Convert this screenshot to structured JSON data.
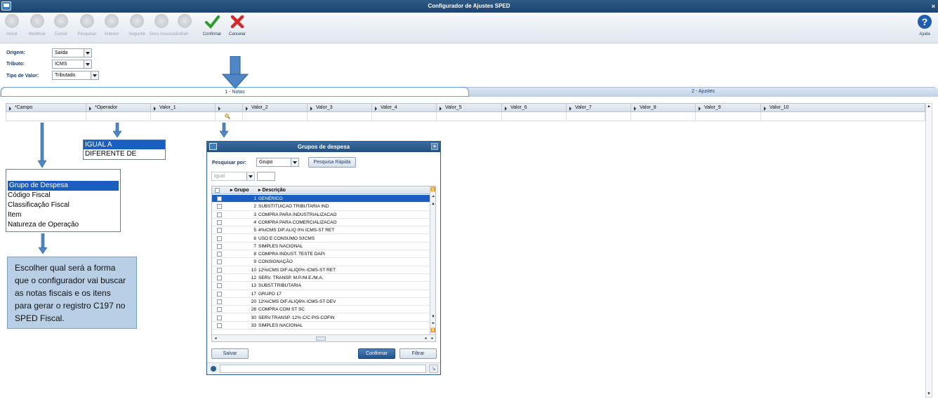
{
  "window": {
    "title": "Configurador de Ajustes SPED"
  },
  "toolbar": {
    "buttons": [
      {
        "label": "Incluir",
        "enabled": false
      },
      {
        "label": "Modificar",
        "enabled": false
      },
      {
        "label": "Excluir",
        "enabled": false
      },
      {
        "label": "Pesquisar",
        "enabled": false
      },
      {
        "label": "Anterior",
        "enabled": false
      },
      {
        "label": "Seguinte",
        "enabled": false
      },
      {
        "label": "Docs Associados",
        "enabled": false
      },
      {
        "label": "Sair",
        "enabled": false
      },
      {
        "label": "Confirmar",
        "enabled": true
      },
      {
        "label": "Cancelar",
        "enabled": true
      }
    ],
    "help_label": "Ajuda"
  },
  "form": {
    "origem_label": "Origem:",
    "origem_value": "Saída",
    "tributo_label": "Tributo:",
    "tributo_value": "ICMS",
    "tipo_label": "Tipo de Valor:",
    "tipo_value": "Tributado"
  },
  "tabs": [
    {
      "label": "1 - Notas",
      "active": true
    },
    {
      "label": "2 - Ajustes",
      "active": false
    }
  ],
  "grid": {
    "columns": [
      "*Campo",
      "*Operador",
      "Valor_1",
      "",
      "Valor_2",
      "Valor_3",
      "Valor_4",
      "Valor_5",
      "Valor_6",
      "Valor_7",
      "Valor_8",
      "Valor_9",
      "Valor_10"
    ]
  },
  "operador_dropdown": [
    "IGUAL A",
    "DIFERENTE DE"
  ],
  "campo_dropdown": [
    "",
    "Grupo de Despesa",
    "Código Fiscal",
    "Classificação Fiscal",
    "Item",
    "Natureza de Operação"
  ],
  "callout": "Escolher qual será a forma que o configurador vai buscar as notas fiscais e os itens para gerar o registro C197 no SPED Fiscal.",
  "dialog": {
    "title": "Grupos de despesa",
    "search_label": "Pesquisar por:",
    "search_field": "Grupo",
    "quick_search_btn": "Pesquisa Rápida",
    "operator": "Igual",
    "search_value": "",
    "col_grupo": "Grupo",
    "col_descricao": "Descrição",
    "rows": [
      {
        "grupo": "1",
        "descricao": "GENÉRICO"
      },
      {
        "grupo": "2",
        "descricao": "SUBSTITUICAO TRIBUTARIA IND"
      },
      {
        "grupo": "3",
        "descricao": "COMPRA PARA INDUSTRIALIZACAO"
      },
      {
        "grupo": "4",
        "descricao": "COMPRA PARA COMERCIALIZACAO"
      },
      {
        "grupo": "5",
        "descricao": "4%ICMS DIF.ALIQ 0% ICMS-ST RET"
      },
      {
        "grupo": "6",
        "descricao": "USO E CONSUMO S/ICMS"
      },
      {
        "grupo": "7",
        "descricao": "SIMPLES NACIONAL"
      },
      {
        "grupo": "8",
        "descricao": "COMPRA INDUST. TESTE DAPI"
      },
      {
        "grupo": "9",
        "descricao": "CONSIGNAÇÃO"
      },
      {
        "grupo": "10",
        "descricao": "12%ICMS DIF.ALIQ0% ICMS-ST RET"
      },
      {
        "grupo": "12",
        "descricao": "SERV. TRANSP. M.P./M.E./M.A."
      },
      {
        "grupo": "13",
        "descricao": "SUBST.TRIBUTARIA"
      },
      {
        "grupo": "17",
        "descricao": "GRUPO 17"
      },
      {
        "grupo": "20",
        "descricao": "12%ICMS DIF.ALIQ6% ICMS-ST DEV"
      },
      {
        "grupo": "28",
        "descricao": "COMPRA COM ST SC"
      },
      {
        "grupo": "30",
        "descricao": "SERV.TRANSP. 12% C/C PIS-COFIN"
      },
      {
        "grupo": "33",
        "descricao": "SIMPLES NACIONAL"
      }
    ],
    "salvar_btn": "Salvar",
    "confirmar_btn": "Confirmar",
    "filtrar_btn": "Filtrar"
  }
}
